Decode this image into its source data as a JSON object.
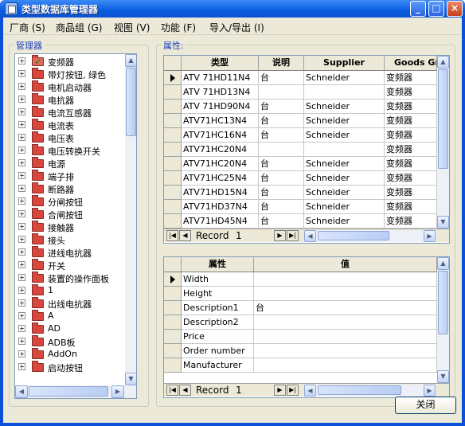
{
  "window": {
    "title": "类型数据库管理器",
    "minimize": "_",
    "maximize": "□",
    "close": "×"
  },
  "menu": [
    "厂商 (S)",
    "商品组 (G)",
    "视图 (V)",
    "功能 (F)",
    "导入/导出 (I)"
  ],
  "manager": {
    "label": "管理器",
    "items": [
      "变频器",
      "带灯按钮, 绿色",
      "电机启动器",
      "电抗器",
      "电流互感器",
      "电流表",
      "电压表",
      "电压转换开关",
      "电源",
      "端子排",
      "断路器",
      "分闸按钮",
      "合闸按钮",
      "接触器",
      "接头",
      "进线电抗器",
      "开关",
      "装置的操作面板",
      "1",
      "出线电抗器",
      "A",
      "AD",
      "ADB板",
      "AddOn",
      "启动按钮"
    ]
  },
  "properties_label": "属性:",
  "type_table": {
    "columns": [
      "类型",
      "说明",
      "Supplier",
      "Goods Gr"
    ],
    "rows": [
      [
        "ATV 71HD11N4",
        "台",
        "Schneider",
        "变频器"
      ],
      [
        "ATV 71HD13N4",
        "",
        "",
        "变频器"
      ],
      [
        "ATV 71HD90N4",
        "台",
        "Schneider",
        "变频器"
      ],
      [
        "ATV71HC13N4",
        "台",
        "Schneider",
        "变频器"
      ],
      [
        "ATV71HC16N4",
        "台",
        "Schneider",
        "变频器"
      ],
      [
        "ATV71HC20N4",
        "",
        "",
        "变频器"
      ],
      [
        "ATV71HC20N4",
        "台",
        "Schneider",
        "变频器"
      ],
      [
        "ATV71HC25N4",
        "台",
        "Schneider",
        "变频器"
      ],
      [
        "ATV71HD15N4",
        "台",
        "Schneider",
        "变频器"
      ],
      [
        "ATV71HD37N4",
        "台",
        "Schneider",
        "变频器"
      ],
      [
        "ATV71HD45N4",
        "台",
        "Schneider",
        "变频器"
      ]
    ],
    "record_label": "Record",
    "record_value": "1"
  },
  "attr_table": {
    "columns": [
      "属性",
      "值"
    ],
    "rows": [
      [
        "Width",
        ""
      ],
      [
        "Height",
        ""
      ],
      [
        "Description1",
        "台"
      ],
      [
        "Description2",
        ""
      ],
      [
        "Price",
        ""
      ],
      [
        "Order number",
        ""
      ],
      [
        "Manufacturer",
        ""
      ]
    ],
    "record_label": "Record",
    "record_value": "1"
  },
  "close_button": "关闭"
}
